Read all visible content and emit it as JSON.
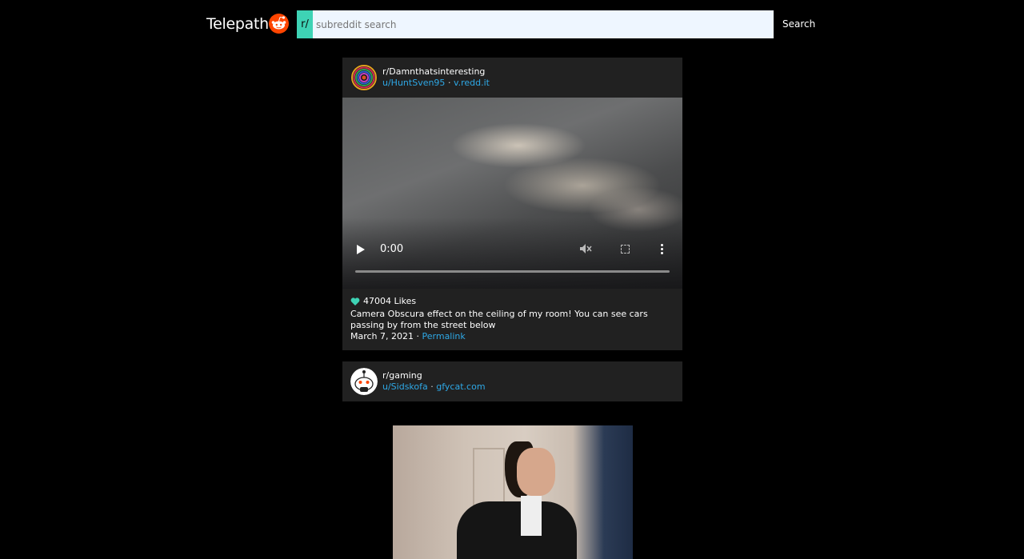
{
  "header": {
    "brand": "Telepath",
    "prefix": "r/",
    "search_placeholder": "subreddit search",
    "search_button": "Search"
  },
  "posts": [
    {
      "subreddit": "r/Damnthatsinteresting",
      "author": "u/HuntSven95",
      "separator": "·",
      "domain": "v.redd.it",
      "video_time": "0:00",
      "likes": "47004 Likes",
      "title": "Camera Obscura effect on the ceiling of my room! You can see cars passing by from the street below",
      "date": "March 7, 2021 ·",
      "permalink": "Permalink"
    },
    {
      "subreddit": "r/gaming",
      "author": "u/Sidskofa",
      "separator": "·",
      "domain": "gfycat.com"
    }
  ],
  "colors": {
    "accent": "#3ed3b5",
    "link": "#2ea8e6",
    "card_bg": "#212121",
    "page_bg": "#000000",
    "logo": "#ff4500"
  }
}
